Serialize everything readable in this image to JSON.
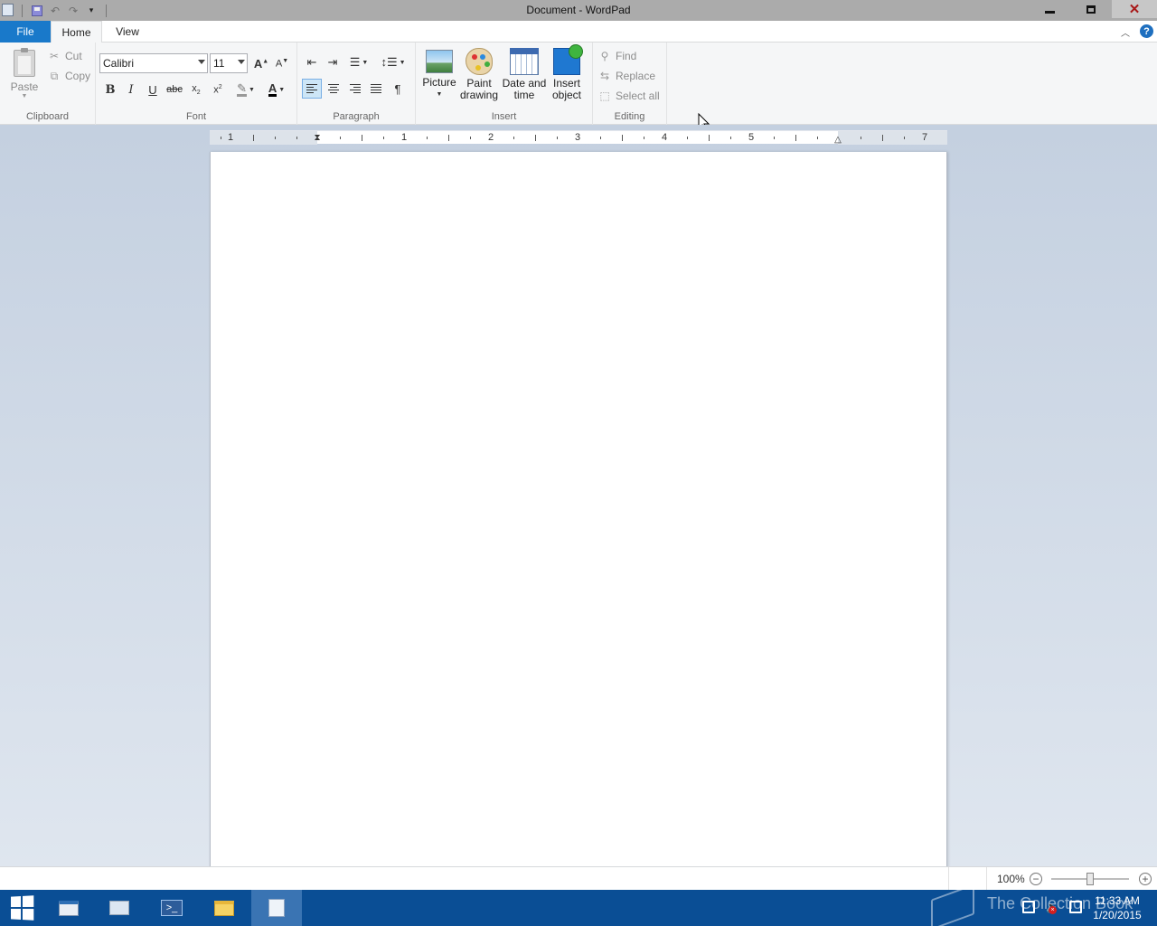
{
  "window": {
    "title": "Document - WordPad",
    "icons": [
      "wordpad-app-icon",
      "save-icon",
      "undo-icon",
      "redo-icon",
      "customize-qat-icon",
      "minimize-icon",
      "restore-icon",
      "close-icon"
    ]
  },
  "tabs": {
    "file": "File",
    "home": "Home",
    "view": "View",
    "active": "Home"
  },
  "clipboard": {
    "paste": "Paste",
    "cut": "Cut",
    "copy": "Copy",
    "label": "Clipboard"
  },
  "font": {
    "family": "Calibri",
    "size": "11",
    "label": "Font",
    "bold": "B",
    "italic": "I",
    "underline": "U",
    "strike": "abc"
  },
  "paragraph": {
    "label": "Paragraph",
    "alignment": "left"
  },
  "insert": {
    "picture": "Picture",
    "paint_drawing_1": "Paint",
    "paint_drawing_2": "drawing",
    "date_time_1": "Date and",
    "date_time_2": "time",
    "insert_object_1": "Insert",
    "insert_object_2": "object",
    "label": "Insert"
  },
  "editing": {
    "find": "Find",
    "replace": "Replace",
    "select_all": "Select all",
    "label": "Editing"
  },
  "ruler": {
    "numbers": [
      "1",
      "1",
      "2",
      "3",
      "4",
      "5",
      "7"
    ]
  },
  "status": {
    "zoom": "100%"
  },
  "taskbar": {
    "watermark": "The Collection Book",
    "time": "11:33 AM",
    "date": "1/20/2015"
  },
  "colors": {
    "file_tab": "#1979ca",
    "taskbar": "#0a4e95",
    "workspace": "#c4d0e0"
  }
}
